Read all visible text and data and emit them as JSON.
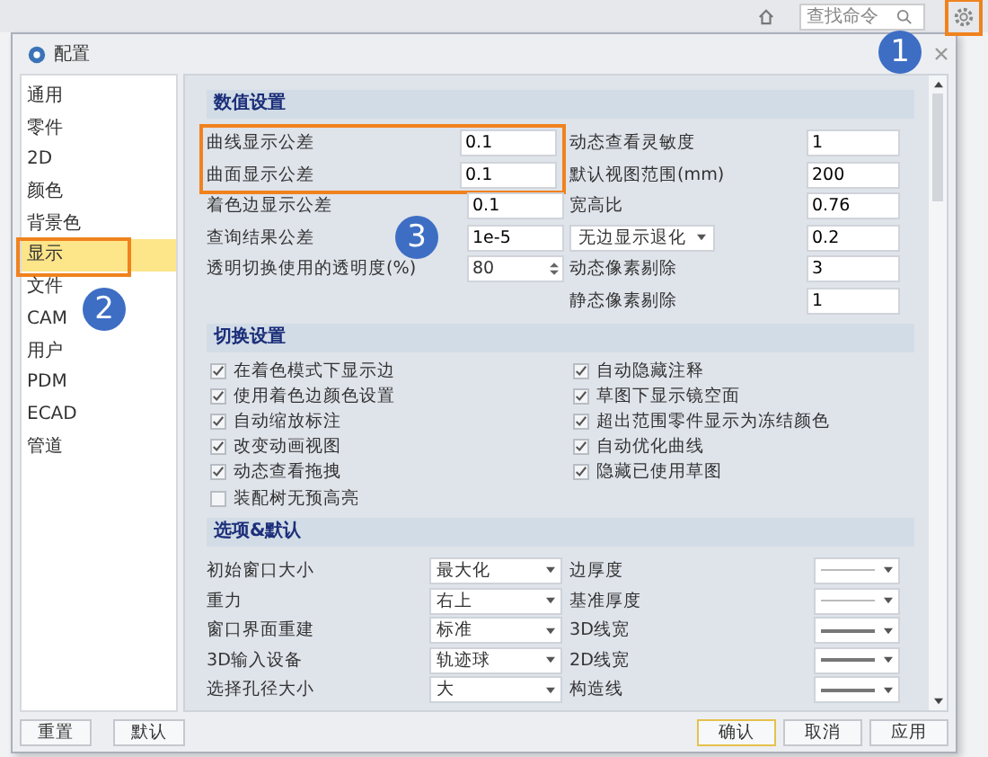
{
  "topbar": {
    "search": {
      "placeholder": "查找命令"
    },
    "settings_framed": true
  },
  "window": {
    "title": "配置"
  },
  "sidebar": {
    "items": [
      {
        "label": "通用",
        "selected": false,
        "framed": false
      },
      {
        "label": "零件",
        "selected": false,
        "framed": false
      },
      {
        "label": "2D",
        "selected": false,
        "framed": false
      },
      {
        "label": "颜色",
        "selected": false,
        "framed": false
      },
      {
        "label": "背景色",
        "selected": false,
        "framed": false
      },
      {
        "label": "显示",
        "selected": true,
        "framed": true
      },
      {
        "label": "文件",
        "selected": false,
        "framed": false
      },
      {
        "label": "CAM",
        "selected": false,
        "framed": false
      },
      {
        "label": "用户",
        "selected": false,
        "framed": false
      },
      {
        "label": "PDM",
        "selected": false,
        "framed": false
      },
      {
        "label": "ECAD",
        "selected": false,
        "framed": false
      },
      {
        "label": "管道",
        "selected": false,
        "framed": false
      }
    ]
  },
  "sections": [
    {
      "title": "数值设置",
      "kind": "fields",
      "left": [
        {
          "label": "曲线显示公差",
          "value": "0.1",
          "kind": "text",
          "framed": true
        },
        {
          "label": "曲面显示公差",
          "value": "0.1",
          "kind": "text",
          "framed": true
        },
        {
          "label": "着色边显示公差",
          "value": "0.1",
          "kind": "text",
          "framed": false
        },
        {
          "label": "查询结果公差",
          "value": "1e-5",
          "kind": "text",
          "framed": false
        },
        {
          "label": "透明切换使用的透明度(%)",
          "value": "80",
          "kind": "spin",
          "framed": false
        }
      ],
      "right": [
        {
          "label": "动态查看灵敏度",
          "value": "1",
          "kind": "label"
        },
        {
          "label": "默认视图范围(mm)",
          "value": "200",
          "kind": "label"
        },
        {
          "label": "宽高比",
          "value": "0.76",
          "kind": "label"
        },
        {
          "label": "无边显示退化",
          "value": "0.2",
          "kind": "select"
        },
        {
          "label": "动态像素剔除",
          "value": "3",
          "kind": "label"
        },
        {
          "label": "静态像素剔除",
          "value": "1",
          "kind": "label"
        }
      ]
    },
    {
      "title": "切换设置",
      "kind": "checks",
      "columns": [
        [
          {
            "label": "在着色模式下显示边",
            "checked": true
          },
          {
            "label": "使用着色边颜色设置",
            "checked": true
          },
          {
            "label": "自动缩放标注",
            "checked": true
          },
          {
            "label": "改变动画视图",
            "checked": true
          },
          {
            "label": "动态查看拖拽",
            "checked": true
          },
          {
            "label": "装配树无预高亮",
            "checked": false
          }
        ],
        [
          {
            "label": "自动隐藏注释",
            "checked": true
          },
          {
            "label": "草图下显示镜空面",
            "checked": true
          },
          {
            "label": "超出范围零件显示为冻结颜色",
            "checked": true
          },
          {
            "label": "自动优化曲线",
            "checked": true
          },
          {
            "label": "隐藏已使用草图",
            "checked": true
          }
        ]
      ]
    },
    {
      "title": "选项&默认",
      "kind": "options",
      "rows": [
        {
          "label": "初始窗口大小",
          "value": "最大化",
          "right_label": "边厚度",
          "thick": false
        },
        {
          "label": "重力",
          "value": "右上",
          "right_label": "基准厚度",
          "thick": false
        },
        {
          "label": "窗口界面重建",
          "value": "标准",
          "right_label": "3D线宽",
          "thick": true
        },
        {
          "label": "3D输入设备",
          "value": "轨迹球",
          "right_label": "2D线宽",
          "thick": true
        },
        {
          "label": "选择孔径大小",
          "value": "大",
          "right_label": "构造线",
          "thick": true
        }
      ]
    }
  ],
  "footer": {
    "left_buttons": [
      "重置",
      "默认"
    ],
    "right_buttons": [
      {
        "label": "确认",
        "default": true
      },
      {
        "label": "取消",
        "default": false
      },
      {
        "label": "应用",
        "default": false
      }
    ]
  },
  "annotations": {
    "badges": [
      "1",
      "2",
      "3"
    ]
  }
}
